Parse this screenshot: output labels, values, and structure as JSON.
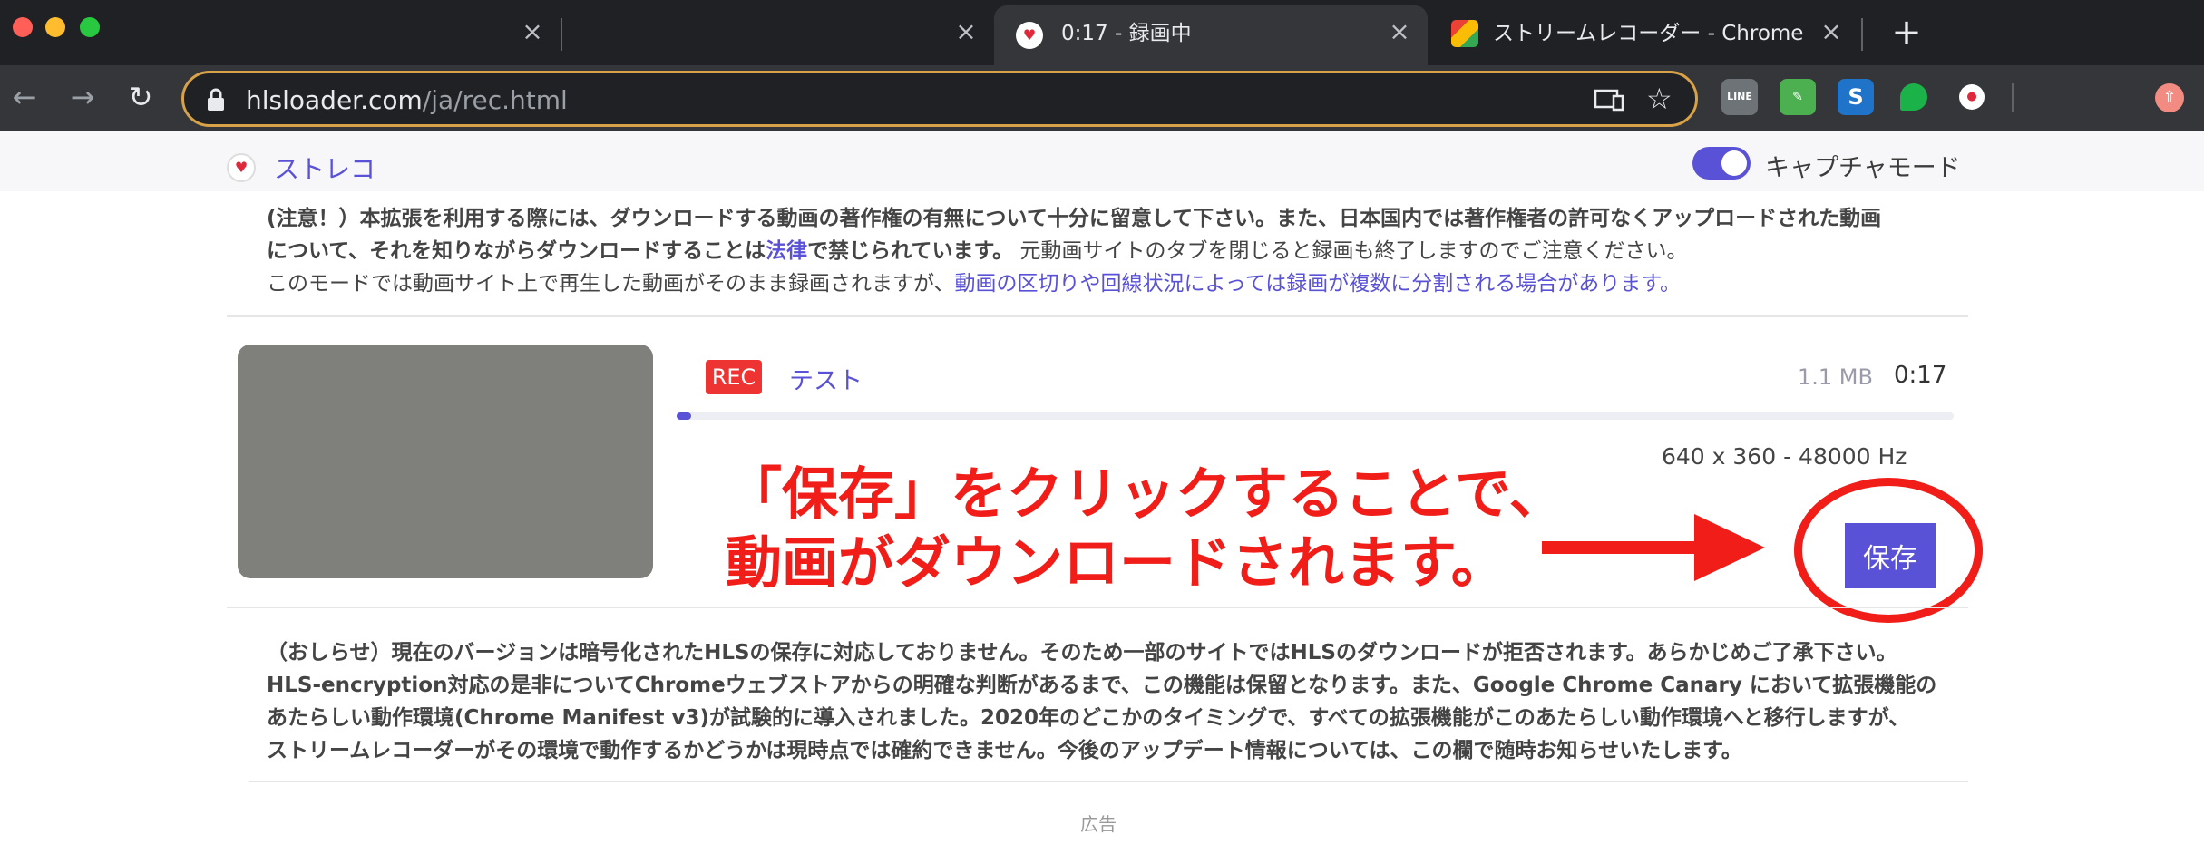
{
  "browser": {
    "tabs": [
      {
        "title": "",
        "active": false
      },
      {
        "title": "",
        "active": false
      },
      {
        "title": "0:17 - 録画中",
        "active": true
      },
      {
        "title": "ストリームレコーダー - Chrome ウ",
        "active": false
      }
    ],
    "new_tab_label": "+",
    "url_host": "hlsloader.com",
    "url_path": "/ja/rec.html",
    "extensions": [
      "line-icon",
      "evernote-icon",
      "s-icon",
      "chat-icon",
      "strec-icon"
    ]
  },
  "app": {
    "brand": "ストレコ",
    "capture_mode_label": "キャプチャモード",
    "capture_mode_on": true,
    "notice_top": {
      "line1_bold": "(注意！）本拡張を利用する際には、ダウンロードする動画の著作権の有無について十分に留意して下さい。また、日本国内では著作権者の許可なくアップロードされた動画",
      "line2_bold_a": "について、それを知りながらダウンロードすることは",
      "line2_link": "法律",
      "line2_bold_b": "で禁じられています。",
      "line2_normal": " 元動画サイトのタブを閉じると録画も終了しますのでご注意ください。",
      "line3_normal": "このモードでは動画サイト上で再生した動画がそのまま録画されますが、",
      "line3_link": "動画の区切りや回線状況によっては録画が複数に分割される場合があります。"
    },
    "recording": {
      "badge": "REC",
      "title": "テスト",
      "size": "1.1 MB",
      "time": "0:17",
      "progress": 0.009,
      "meta": "640 x 360 - 48000 Hz",
      "save_label": "保存"
    },
    "annotation": {
      "line1": "「保存」をクリックすることで、",
      "line2": "動画がダウンロードされます。"
    },
    "notice_bottom": [
      "（おしらせ）現在のバージョンは暗号化されたHLSの保存に対応しておりません。そのため一部のサイトではHLSのダウンロードが拒否されます。あらかじめご了承下さい。",
      "HLS-encryption対応の是非についてChromeウェブストアからの明確な判断があるまで、この機能は保留となります。また、Google Chrome Canary において拡張機能の",
      "あたらしい動作環境(Chrome Manifest v3)が試験的に導入されました。2020年のどこかのタイミングで、すべての拡張機能がこのあたらしい動作環境へと移行しますが、",
      "ストリームレコーダーがその環境で動作するかどうかは現時点では確約できません。今後のアップデート情報については、この欄で随時お知らせいたします。"
    ],
    "ad_label": "広告"
  },
  "colors": {
    "accent": "#5a52d6",
    "rec": "#e33333",
    "annotation": "#f01d18"
  }
}
